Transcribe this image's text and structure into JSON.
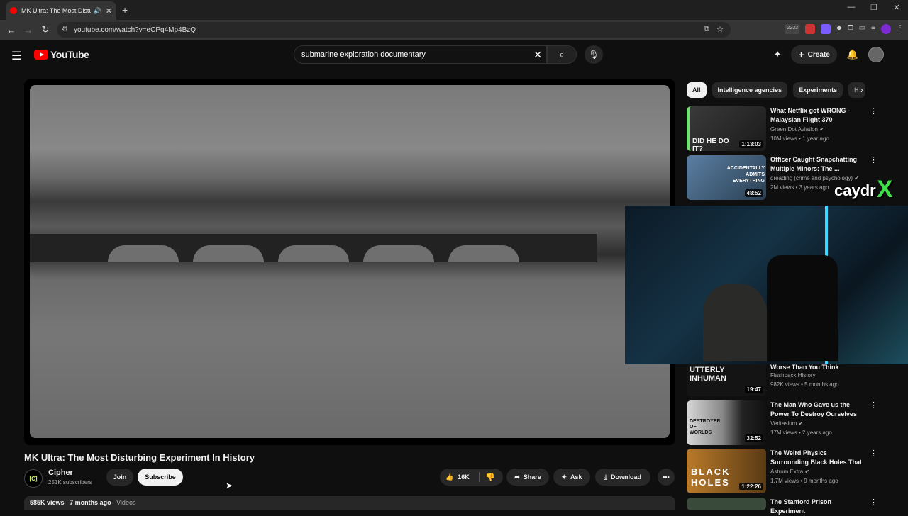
{
  "browser": {
    "tab_title": "MK Ultra: The Most Disturbi",
    "url": "youtube.com/watch?v=eCPq4Mp4BzQ",
    "ext_badge": "2233"
  },
  "header": {
    "logo_text": "YouTube",
    "search_value": "submarine exploration documentary",
    "create_label": "Create"
  },
  "video": {
    "title": "MK Ultra: The Most Disturbing Experiment In History",
    "channel_name": "Cipher",
    "channel_subs": "251K subscribers",
    "channel_avatar_text": "[C]",
    "join_label": "Join",
    "subscribe_label": "Subscribe",
    "likes": "16K",
    "share_label": "Share",
    "ask_label": "Ask",
    "download_label": "Download",
    "views": "585K views",
    "age": "7 months ago",
    "desc_link": "Videos"
  },
  "chips": [
    "All",
    "Intelligence agencies",
    "Experiments",
    "H"
  ],
  "recommendations": [
    {
      "title": "What Netflix got WRONG - Malaysian Flight 370",
      "channel": "Green Dot Aviation",
      "meta": "10M views • 1 year ago",
      "duration": "1:13:03",
      "thumb_text": "DID HE DO IT?"
    },
    {
      "title": "Officer Caught Snapchatting Multiple Minors: The ...",
      "channel": "dreading (crime and psychology)",
      "meta": "2M views • 3 years ago",
      "duration": "48:52",
      "thumb_text": "ACCIDENTALLY ADMITS EVERYTHING"
    },
    {
      "title": "Worse Than You Think",
      "channel": "Flashback History",
      "meta": "982K views • 5 months ago",
      "duration": "19:47",
      "thumb_text": "UTTERLY INHUMAN"
    },
    {
      "title": "The Man Who Gave us the Power To Destroy Ourselves ...",
      "channel": "Veritasium",
      "meta": "17M views • 2 years ago",
      "duration": "32:52",
      "thumb_text": "DESTROYER OF WORLDS"
    },
    {
      "title": "The Weird Physics Surrounding Black Holes That Will Make Yo...",
      "channel": "Astrum Extra",
      "meta": "1.7M views • 9 months ago",
      "duration": "1:22:26",
      "thumb_text": "BLACK HOLES"
    },
    {
      "title": "The Stanford Prison Experiment",
      "channel": "",
      "meta": "",
      "duration": "",
      "thumb_text": ""
    }
  ],
  "overlay": {
    "streamer_name": "caydr",
    "streamer_mark": "X"
  }
}
